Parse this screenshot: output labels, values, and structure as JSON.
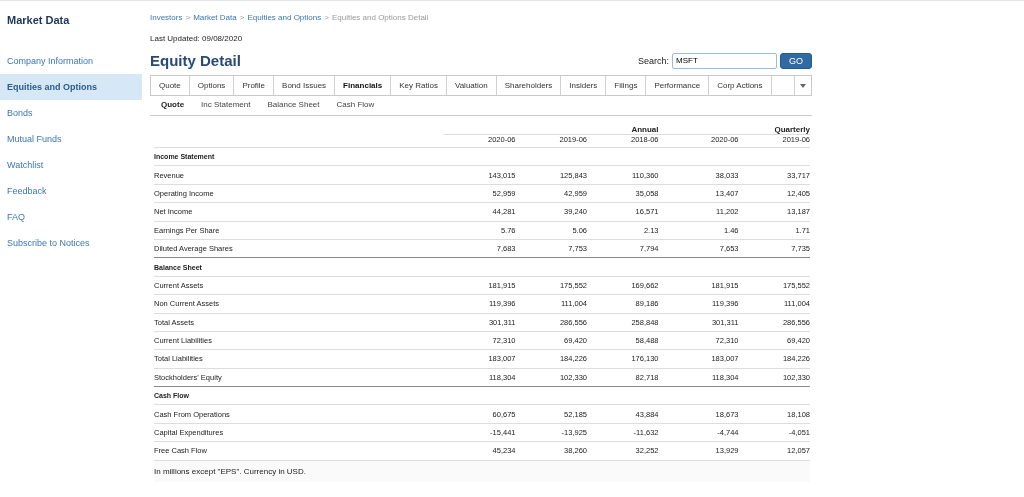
{
  "sidebar": {
    "title": "Market Data",
    "items": [
      {
        "label": "Company Information",
        "selected": false
      },
      {
        "label": "Equities and Options",
        "selected": true
      },
      {
        "label": "Bonds",
        "selected": false
      },
      {
        "label": "Mutual Funds",
        "selected": false
      },
      {
        "label": "Watchlist",
        "selected": false
      },
      {
        "label": "Feedback",
        "selected": false
      },
      {
        "label": "FAQ",
        "selected": false
      },
      {
        "label": "Subscribe to Notices",
        "selected": false
      }
    ]
  },
  "breadcrumb": [
    {
      "label": "Investors",
      "current": false
    },
    {
      "label": "Market Data",
      "current": false
    },
    {
      "label": "Equities and Options",
      "current": false
    },
    {
      "label": "Equities and Options Detail",
      "current": true
    }
  ],
  "breadcrumb_separator": ">",
  "last_updated": "Last Updated: 09/08/2020",
  "page_title": "Equity Detail",
  "search": {
    "label": "Search:",
    "value": "MSFT",
    "button": "GO"
  },
  "tabs": [
    {
      "label": "Quote",
      "selected": false
    },
    {
      "label": "Options",
      "selected": false
    },
    {
      "label": "Profile",
      "selected": false
    },
    {
      "label": "Bond Issues",
      "selected": false
    },
    {
      "label": "Financials",
      "selected": true
    },
    {
      "label": "Key Ratios",
      "selected": false
    },
    {
      "label": "Valuation",
      "selected": false
    },
    {
      "label": "Shareholders",
      "selected": false
    },
    {
      "label": "Insiders",
      "selected": false
    },
    {
      "label": "Filings",
      "selected": false
    },
    {
      "label": "Performance",
      "selected": false
    },
    {
      "label": "Corp Actions",
      "selected": false
    }
  ],
  "subtabs": [
    {
      "label": "Quote",
      "selected": true
    },
    {
      "label": "Inc Statement",
      "selected": false
    },
    {
      "label": "Balance Sheet",
      "selected": false
    },
    {
      "label": "Cash Flow",
      "selected": false
    }
  ],
  "table": {
    "column_groups": [
      {
        "label": "Annual",
        "columns": [
          "2020-06",
          "2019-06",
          "2018-06"
        ]
      },
      {
        "label": "Quarterly",
        "columns": [
          "2020-06",
          "2019-06"
        ]
      }
    ],
    "sections": [
      {
        "title": "Income Statement",
        "rows": [
          {
            "label": "Revenue",
            "values": [
              "143,015",
              "125,843",
              "110,360",
              "38,033",
              "33,717"
            ]
          },
          {
            "label": "Operating Income",
            "values": [
              "52,959",
              "42,959",
              "35,058",
              "13,407",
              "12,405"
            ]
          },
          {
            "label": "Net Income",
            "values": [
              "44,281",
              "39,240",
              "16,571",
              "11,202",
              "13,187"
            ]
          },
          {
            "label": "Earnings Per Share",
            "values": [
              "5.76",
              "5.06",
              "2.13",
              "1.46",
              "1.71"
            ]
          },
          {
            "label": "Diluted Average Shares",
            "values": [
              "7,683",
              "7,753",
              "7,794",
              "7,653",
              "7,735"
            ]
          }
        ]
      },
      {
        "title": "Balance Sheet",
        "rows": [
          {
            "label": "Current Assets",
            "values": [
              "181,915",
              "175,552",
              "169,662",
              "181,915",
              "175,552"
            ]
          },
          {
            "label": "Non Current Assets",
            "values": [
              "119,396",
              "111,004",
              "89,186",
              "119,396",
              "111,004"
            ]
          },
          {
            "label": "Total Assets",
            "values": [
              "301,311",
              "286,556",
              "258,848",
              "301,311",
              "286,556"
            ]
          },
          {
            "label": "Current Liabilities",
            "values": [
              "72,310",
              "69,420",
              "58,488",
              "72,310",
              "69,420"
            ]
          },
          {
            "label": "Total Liabilities",
            "values": [
              "183,007",
              "184,226",
              "176,130",
              "183,007",
              "184,226"
            ]
          },
          {
            "label": "Stockholders' Equity",
            "values": [
              "118,304",
              "102,330",
              "82,718",
              "118,304",
              "102,330"
            ]
          }
        ]
      },
      {
        "title": "Cash Flow",
        "rows": [
          {
            "label": "Cash From Operations",
            "values": [
              "60,675",
              "52,185",
              "43,884",
              "18,673",
              "18,108"
            ]
          },
          {
            "label": "Capital Expenditures",
            "values": [
              "-15,441",
              "-13,925",
              "-11,632",
              "-4,744",
              "-4,051"
            ]
          },
          {
            "label": "Free Cash Flow",
            "values": [
              "45,234",
              "38,260",
              "32,252",
              "13,929",
              "12,057"
            ]
          }
        ]
      }
    ],
    "footnote": "In millions except \"EPS\". Currency in USD."
  }
}
